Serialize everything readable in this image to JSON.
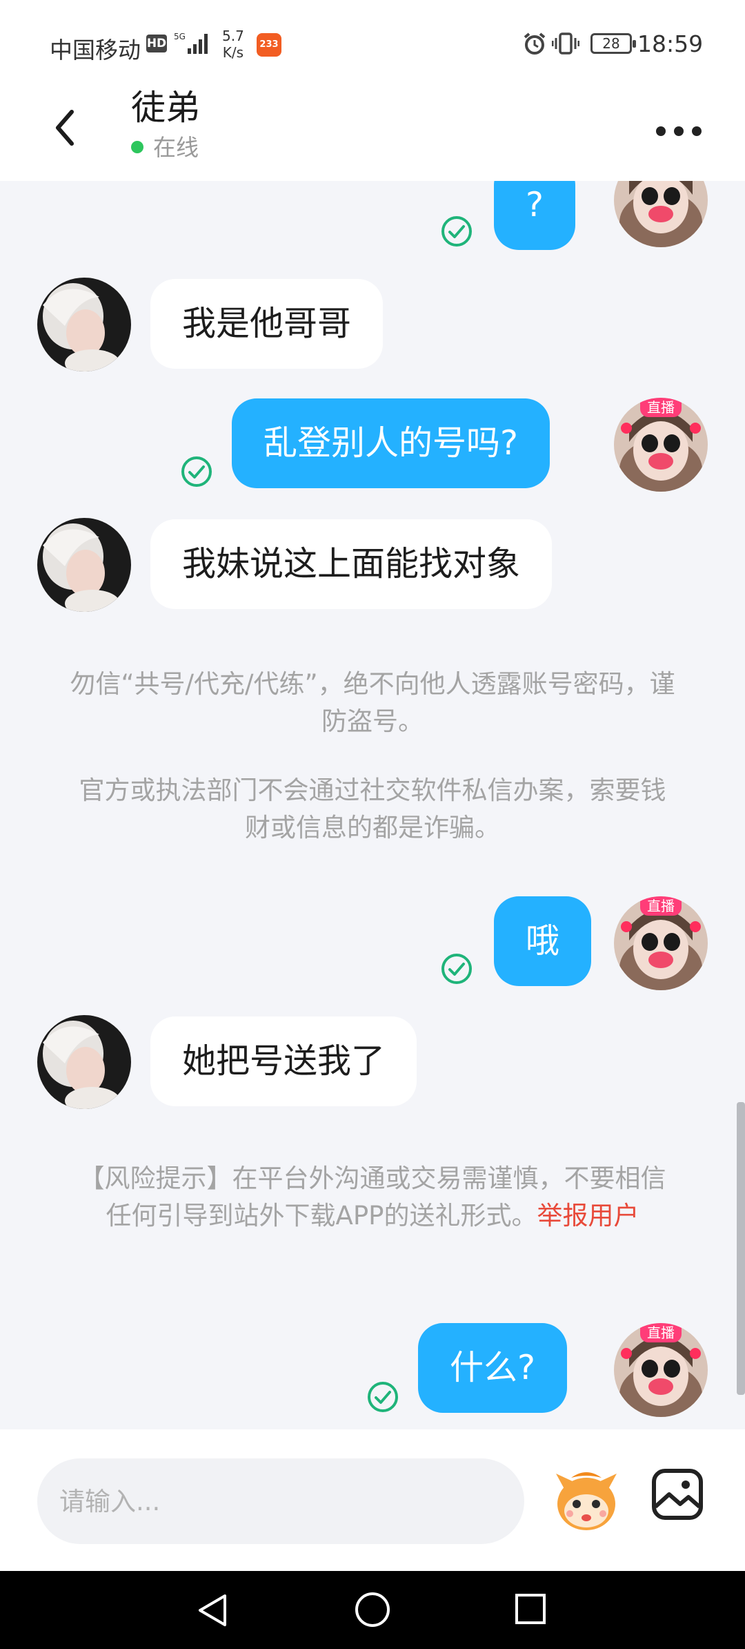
{
  "status_bar": {
    "carrier": "中国移动",
    "hd_badge": "HD",
    "network_speed_value": "5.7",
    "network_speed_unit": "K/s",
    "app_badge": "233",
    "battery": "28",
    "time": "18:59"
  },
  "header": {
    "title": "徒弟",
    "online_status": "在线",
    "online_color": "#2dc65d"
  },
  "live_badge": "直播",
  "messages": [
    {
      "sender": "me",
      "text": "?",
      "status": "read"
    },
    {
      "sender": "other",
      "text": "我是他哥哥"
    },
    {
      "sender": "me",
      "text": "乱登别人的号吗?",
      "status": "read"
    },
    {
      "sender": "other",
      "text": "我妹说这上面能找对象"
    },
    {
      "sender": "me",
      "text": "哦",
      "status": "read"
    },
    {
      "sender": "other",
      "text": "她把号送我了"
    },
    {
      "sender": "me",
      "text": "什么?",
      "status": "read"
    }
  ],
  "notices": {
    "account_safety": "勿信“共号/代充/代练”，绝不向他人透露账号密码，谨防盗号。",
    "fraud_warning": "官方或执法部门不会通过社交软件私信办案，索要钱财或信息的都是诈骗。",
    "risk_tip": "【风险提示】在平台外沟通或交易需谨慎，不要相信任何引导到站外下载APP的送礼形式。",
    "report_link": "举报用户"
  },
  "input": {
    "placeholder": "请输入..."
  },
  "colors": {
    "my_bubble": "#24b1ff",
    "other_bubble": "#ffffff",
    "read_check": "#1fb47a",
    "report_link": "#e84a3a",
    "background": "#f4f5f9"
  },
  "icons": {
    "back": "chevron-left-icon",
    "more": "more-horizontal-icon",
    "read": "check-circle-icon",
    "emoji": "mascot-emoji-icon",
    "image": "image-icon"
  }
}
